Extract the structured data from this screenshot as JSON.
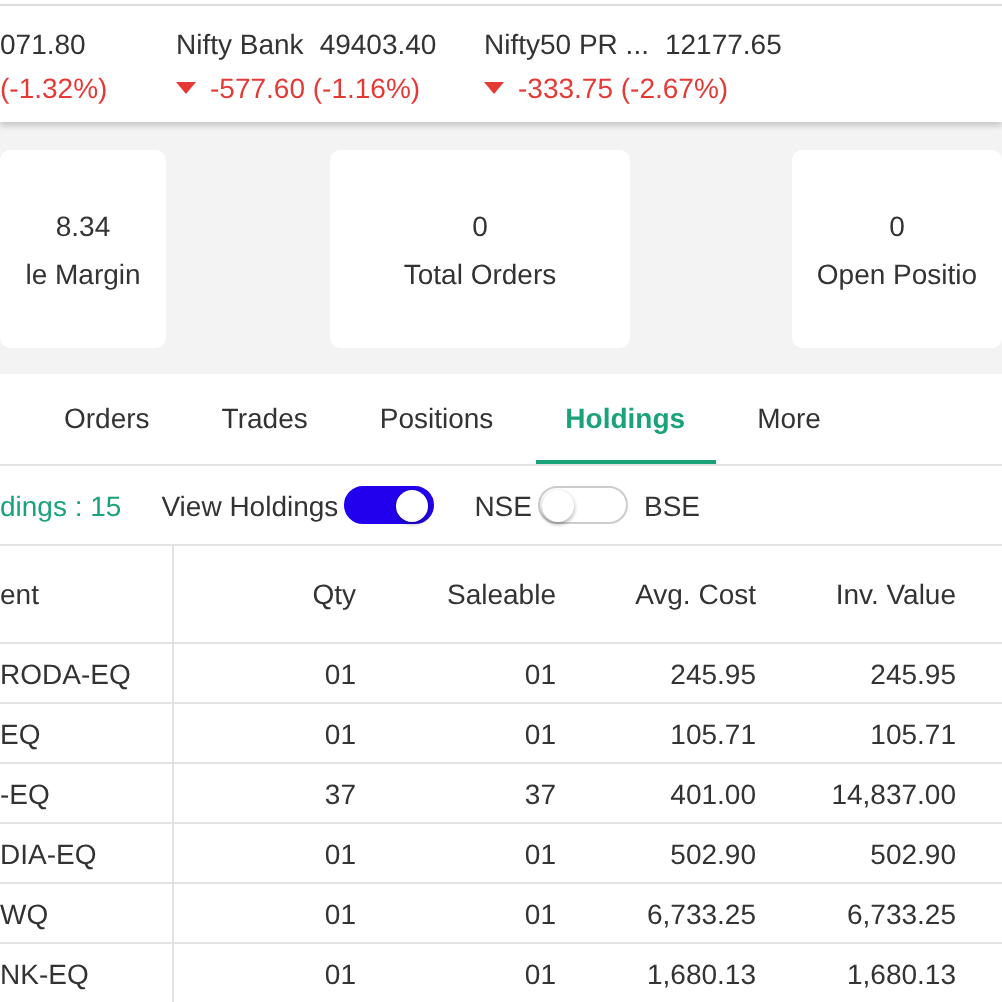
{
  "ticker": [
    {
      "price": "071.80",
      "change": "(-1.32%)",
      "down": true,
      "arrow": false
    },
    {
      "name": "Nifty Bank",
      "price": "49403.40",
      "change": "-577.60 (-1.16%)",
      "down": true,
      "arrow": true
    },
    {
      "name": "Nifty50 PR ...",
      "price": "12177.65",
      "change": "-333.75 (-2.67%)",
      "down": true,
      "arrow": true
    }
  ],
  "cards": [
    {
      "value": "8.34",
      "label": "le Margin"
    },
    {
      "value": "0",
      "label": "Total Orders"
    },
    {
      "value": "0",
      "label": "Open Positio"
    }
  ],
  "tabs": [
    {
      "label": "Orders",
      "selected": false
    },
    {
      "label": "Trades",
      "selected": false
    },
    {
      "label": "Positions",
      "selected": false
    },
    {
      "label": "Holdings",
      "selected": true
    },
    {
      "label": "More",
      "selected": false
    }
  ],
  "filters": {
    "count": "dings : 15",
    "view_label": "View Holdings",
    "view_on": true,
    "left_label": "NSE",
    "exchange_on": false,
    "right_label": "BSE"
  },
  "table": {
    "columns": [
      "ent",
      "Qty",
      "Saleable",
      "Avg. Cost",
      "Inv. Value"
    ],
    "rows": [
      [
        "RODA-EQ",
        "01",
        "01",
        "245.95",
        "245.95"
      ],
      [
        "EQ",
        "01",
        "01",
        "105.71",
        "105.71"
      ],
      [
        "-EQ",
        "37",
        "37",
        "401.00",
        "14,837.00"
      ],
      [
        "DIA-EQ",
        "01",
        "01",
        "502.90",
        "502.90"
      ],
      [
        "WQ",
        "01",
        "01",
        "6,733.25",
        "6,733.25"
      ],
      [
        "NK-EQ",
        "01",
        "01",
        "1,680.13",
        "1,680.13"
      ]
    ]
  }
}
